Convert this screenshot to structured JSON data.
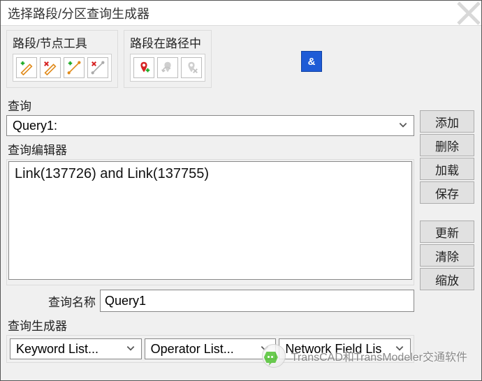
{
  "window": {
    "title": "选择路段/分区查询生成器"
  },
  "tools": {
    "link_node_label": "路段/节点工具",
    "on_path_label": "路段在路径中",
    "and_label": "&"
  },
  "query": {
    "section_label": "查询",
    "current": "Query1:"
  },
  "editor": {
    "section_label": "查询编辑器",
    "text": "Link(137726) and Link(137755)"
  },
  "query_name": {
    "label": "查询名称",
    "value": "Query1"
  },
  "builder": {
    "section_label": "查询生成器",
    "keyword": "Keyword List...",
    "operator": "Operator List...",
    "netfield": "Network Field Lis"
  },
  "buttons": {
    "add": "添加",
    "delete": "删除",
    "load": "加载",
    "save": "保存",
    "refresh": "更新",
    "clear": "清除",
    "zoom": "缩放"
  },
  "watermark": {
    "text": "TransCAD和TransModeler交通软件"
  }
}
